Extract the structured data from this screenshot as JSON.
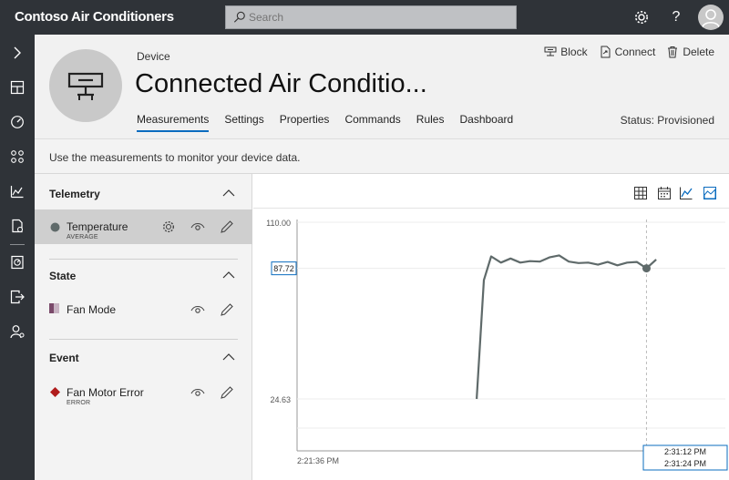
{
  "app": {
    "title": "Contoso Air Conditioners"
  },
  "search": {
    "placeholder": "Search"
  },
  "topbar": {
    "settings_icon": "gear-icon",
    "help_label": "?",
    "avatar_icon": "person-icon"
  },
  "header": {
    "device_label": "Device",
    "device_name": "Connected Air Conditio...",
    "actions": [
      {
        "label": "Block",
        "icon": "block-icon"
      },
      {
        "label": "Connect",
        "icon": "connect-icon"
      },
      {
        "label": "Delete",
        "icon": "trash-icon"
      }
    ],
    "tabs": [
      {
        "label": "Measurements",
        "active": true
      },
      {
        "label": "Settings"
      },
      {
        "label": "Properties"
      },
      {
        "label": "Commands"
      },
      {
        "label": "Rules"
      },
      {
        "label": "Dashboard"
      }
    ],
    "status": "Status: Provisioned"
  },
  "info": {
    "text": "Use the measurements to monitor your device data."
  },
  "panel": {
    "telemetry": {
      "title": "Telemetry",
      "item_label": "Temperature",
      "item_sub": "AVERAGE"
    },
    "state": {
      "title": "State",
      "item_label": "Fan Mode"
    },
    "event": {
      "title": "Event",
      "item_label": "Fan Motor Error",
      "item_sub": "ERROR"
    }
  },
  "colors": {
    "accent": "#0b6cbf",
    "topbar": "#2f3338",
    "series": "#5f6a6a",
    "event": "#b01c1c"
  },
  "chart_data": {
    "type": "line",
    "ylim": [
      24.63,
      110.0
    ],
    "y_top_label": "110.00",
    "y_bottom_label": "24.63",
    "current_value_label": "87.72",
    "x_start_label": "2:21:36 PM",
    "x_cursor_label_1": "2:31:12 PM",
    "x_cursor_label_2": "2:31:24 PM",
    "series": [
      {
        "x": [
          0.0,
          0.3,
          0.6,
          1.0,
          1.4,
          1.8,
          2.2,
          2.6,
          3.0,
          3.4,
          3.8,
          4.2,
          4.6,
          5.0,
          5.4,
          5.8,
          6.2,
          6.6,
          7.0,
          7.4
        ],
        "y": [
          24.63,
          82.0,
          93.5,
          90.5,
          92.5,
          90.5,
          91.2,
          91.0,
          93.0,
          94.0,
          91.0,
          90.3,
          90.5,
          89.5,
          90.8,
          89.2,
          90.5,
          90.8,
          87.72,
          92.0
        ]
      }
    ],
    "x_range": [
      -7.4,
      10.25
    ],
    "cursor_x": 7.0,
    "cursor_y": 87.72
  }
}
